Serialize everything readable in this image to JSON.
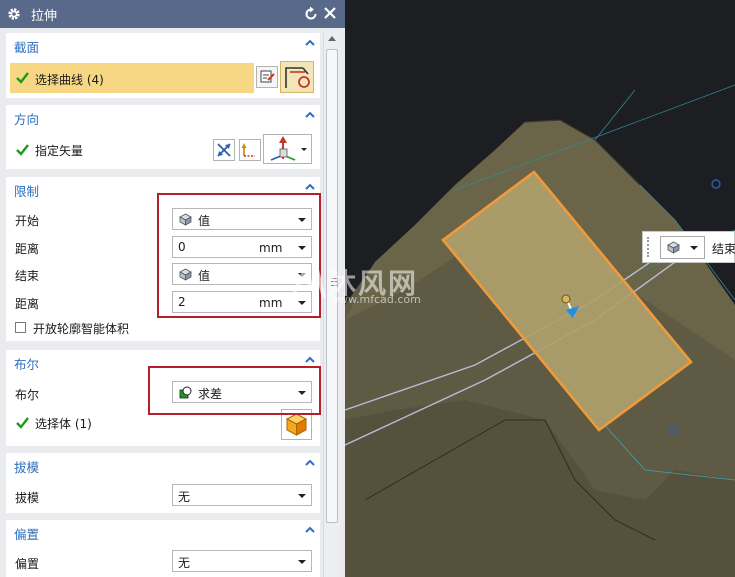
{
  "dialog": {
    "title": "拉伸"
  },
  "sections": {
    "section": {
      "title": "截面",
      "select_curve_label": "选择曲线 (4)"
    },
    "direction": {
      "title": "方向",
      "specify_vector_label": "指定矢量"
    },
    "limits": {
      "title": "限制",
      "start_label": "开始",
      "start_value": "值",
      "start_distance_label": "距离",
      "start_distance_value": "0",
      "start_distance_unit": "mm",
      "end_label": "结束",
      "end_value": "值",
      "end_distance_label": "距离",
      "end_distance_value": "2",
      "end_distance_unit": "mm",
      "open_profile_label": "开放轮廓智能体积",
      "open_profile_checked": false
    },
    "boolean": {
      "title": "布尔",
      "boolean_label": "布尔",
      "boolean_value": "求差",
      "select_body_label": "选择体 (1)"
    },
    "draft": {
      "title": "拔模",
      "draft_label": "拔模",
      "draft_value": "无"
    },
    "offset": {
      "title": "偏置",
      "offset_label": "偏置",
      "offset_value": "无"
    }
  },
  "viewport": {
    "floating_toolbar_text": "结束",
    "watermark_main": "沐风网",
    "watermark_url": "www.mfcad.com"
  },
  "colors": {
    "title_bar": "#58698a",
    "section_title": "#2f6fc0",
    "highlight": "#f7d684",
    "annotation_box": "#b3202c",
    "check": "#1b9a1b",
    "model_body": "#5f5a44",
    "selected_face": "#b0a06c",
    "selected_edge": "#f09a3a"
  }
}
